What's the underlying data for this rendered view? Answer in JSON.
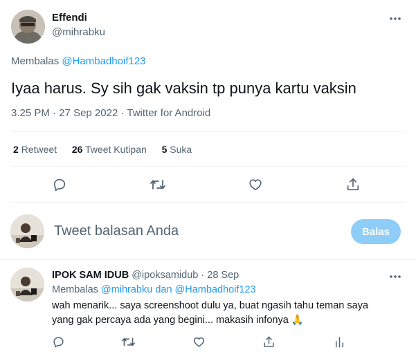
{
  "tweet": {
    "author_name": "Effendi",
    "author_handle": "@mihrabku",
    "reply_prefix": "Membalas",
    "reply_to": "@Hambadhoif123",
    "text": "Iyaa harus. Sy sih gak vaksin tp punya kartu vaksin",
    "time": "3.25 PM",
    "date": "27 Sep 2022",
    "source": "Twitter for Android",
    "separator": "·",
    "stats": {
      "retweets_count": "2",
      "retweets_label": "Retweet",
      "quotes_count": "26",
      "quotes_label": "Tweet Kutipan",
      "likes_count": "5",
      "likes_label": "Suka"
    },
    "actions": [
      "reply-icon",
      "retweet-icon",
      "like-icon",
      "share-icon"
    ]
  },
  "composer": {
    "placeholder": "Tweet balasan Anda",
    "reply_button": "Balas",
    "accent": "#1d9bf0"
  },
  "reply": {
    "author_name": "IPOK SAM IDUB",
    "author_handle": "@ipoksamidub",
    "separator": "·",
    "date": "28 Sep",
    "reply_prefix": "Membalas",
    "reply_to_1": "@mihrabku",
    "reply_conj": "dan",
    "reply_to_2": "@Hambadhoif123",
    "text_line1": "wah menarik... saya screenshoot dulu ya, buat ngasih tahu teman saya",
    "text_line2": "yang gak percaya ada yang begini... makasih infonya",
    "emoji": "🙏",
    "actions": [
      "reply-icon",
      "retweet-icon",
      "like-icon",
      "share-icon",
      "analytics-icon"
    ]
  }
}
